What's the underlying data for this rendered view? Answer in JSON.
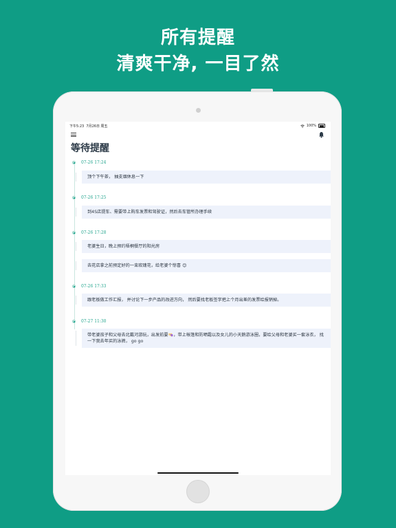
{
  "headline": {
    "line1": "所有提醒",
    "line2": "清爽干净, 一目了然"
  },
  "status_bar": {
    "time": "下午5:23",
    "date": "7月26日 周五",
    "battery": "100%"
  },
  "nav": {
    "title": "等待提醒"
  },
  "icons": {
    "menu": "menu-icon",
    "notification": "bell-icon",
    "wifi": "wifi-icon",
    "battery": "battery-icon"
  },
  "colors": {
    "background": "#0f9d85",
    "accent": "#23a58e",
    "card": "#eef2fb",
    "title": "#2d3b48"
  },
  "reminders": [
    {
      "date": "07-26 17:24",
      "items": [
        "顶个下午茶， 抽支烟休息一下"
      ]
    },
    {
      "date": "07-26 17:25",
      "items": [
        "到4S店提车、需要带上购车发票和驾驶证，然后去车管所办理手续"
      ]
    },
    {
      "date": "07-26 17:28",
      "items": [
        "老婆生日，晚上预约梧桐餐厅的阳光房",
        "去花店拿之前预定好的一束玫瑰花，给老婆个惊喜 😊"
      ]
    },
    {
      "date": "07-26 17:33",
      "items": [
        "跟老板做工作汇报， 并讨论下一步产品的改进方向， 然后要找老板签字把上个月出差的发票给报销掉。"
      ]
    },
    {
      "date": "07-27 11:30",
      "items": [
        "带老婆孩子和父母去北戴河游玩，出发前要👒，带上帐篷和防晒霜以及女儿的小天鹅游泳圈，要给父母和老婆买一套泳衣， 找一下我去年买的泳裤， go go"
      ]
    }
  ]
}
